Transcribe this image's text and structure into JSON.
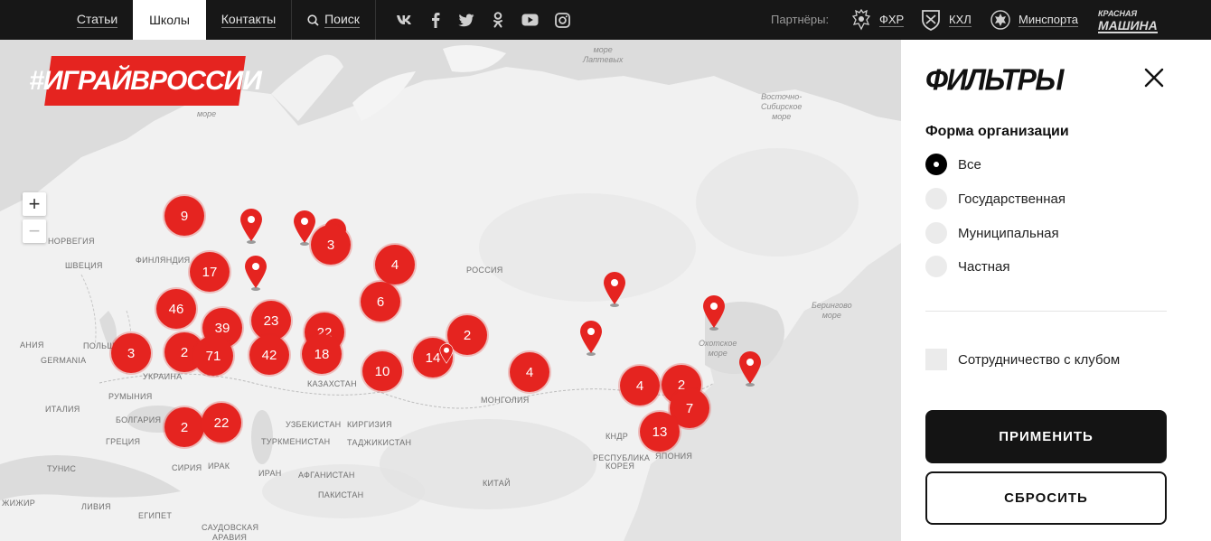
{
  "nav": {
    "items": [
      {
        "label": "Статьи"
      },
      {
        "label": "Школы",
        "active": true
      },
      {
        "label": "Контакты"
      },
      {
        "label": "Поиск"
      }
    ],
    "social_icons": [
      "vk-icon",
      "facebook-icon",
      "twitter-icon",
      "odnoklassniki-icon",
      "youtube-icon",
      "instagram-icon"
    ],
    "partners_label": "Партнёры:",
    "partners": [
      {
        "label": "ФХР",
        "icon": "fhr-emblem-icon"
      },
      {
        "label": "КХЛ",
        "icon": "khl-shield-icon"
      },
      {
        "label": "Минспорта",
        "icon": "minsport-emblem-icon"
      }
    ],
    "krasnaya_mashina": {
      "line1": "КРАСНАЯ",
      "line2": "МАШИНА"
    }
  },
  "brand": {
    "text": "#ИГРАЙВРОССИИ"
  },
  "map": {
    "zoom_in": "+",
    "zoom_out": "−",
    "countries": [
      {
        "text": "НОРВЕГИЯ"
      },
      {
        "text": "ШВЕЦИЯ"
      },
      {
        "text": "ФИНЛЯНДИЯ"
      },
      {
        "text": "РОССИЯ"
      },
      {
        "text": "ПОЛЬША"
      },
      {
        "text": "GERMANIA"
      },
      {
        "text": "АНИЯ"
      },
      {
        "text": "УКРАИНА"
      },
      {
        "text": "РУМЫНИЯ"
      },
      {
        "text": "ИТАЛИЯ"
      },
      {
        "text": "БОЛГАРИЯ"
      },
      {
        "text": "ГРЕЦИЯ"
      },
      {
        "text": "ТУНИС"
      },
      {
        "text": "СИРИЯ"
      },
      {
        "text": "ИРАК"
      },
      {
        "text": "ИРАН"
      },
      {
        "text": "ЕГИПЕТ"
      },
      {
        "text": "ЛИВИЯ"
      },
      {
        "text": "ЖИЖИР"
      },
      {
        "text": "САУДОВСКАЯ"
      },
      {
        "text": "АРАВИЯ"
      },
      {
        "text": "КАЗАХСТАН"
      },
      {
        "text": "УЗБЕКИСТАН"
      },
      {
        "text": "ТУРКМЕНИСТАН"
      },
      {
        "text": "КИРГИЗИЯ"
      },
      {
        "text": "ТАДЖИКИСТАН"
      },
      {
        "text": "АФГАНИСТАН"
      },
      {
        "text": "ПАКИСТАН"
      },
      {
        "text": "МОНГОЛИЯ"
      },
      {
        "text": "КИТАЙ"
      },
      {
        "text": "КНДР"
      },
      {
        "text": "РЕСПУБЛИКА"
      },
      {
        "text": "КОРЕЯ"
      },
      {
        "text": "ЯПОНИЯ"
      }
    ],
    "seas": [
      {
        "text": "море\nЛаптевых"
      },
      {
        "text": "Восточно-\nСибирское\nморе"
      },
      {
        "text": "Берингово\nморе"
      },
      {
        "text": "Охотское\nморе"
      },
      {
        "text": "море"
      }
    ],
    "clusters": [
      {
        "count": "9"
      },
      {
        "count": "17"
      },
      {
        "count": "46"
      },
      {
        "count": "39"
      },
      {
        "count": "3"
      },
      {
        "count": "2"
      },
      {
        "count": "71"
      },
      {
        "count": "23"
      },
      {
        "count": "42"
      },
      {
        "count": "22"
      },
      {
        "count": "18"
      },
      {
        "count": "3"
      },
      {
        "count": "4"
      },
      {
        "count": "6"
      },
      {
        "count": "10"
      },
      {
        "count": "14"
      },
      {
        "count": "2"
      },
      {
        "count": "4"
      },
      {
        "count": "2"
      },
      {
        "count": "22"
      },
      {
        "count": "4"
      },
      {
        "count": "2"
      },
      {
        "count": "7"
      },
      {
        "count": "13"
      }
    ],
    "pin_count": 8
  },
  "filters": {
    "title": "ФИЛЬТРЫ",
    "group_title": "Форма организации",
    "options": [
      {
        "label": "Все",
        "selected": true
      },
      {
        "label": "Государственная",
        "selected": false
      },
      {
        "label": "Муниципальная",
        "selected": false
      },
      {
        "label": "Частная",
        "selected": false
      }
    ],
    "checkbox_label": "Сотрудничество с клубом",
    "apply_label": "ПРИМЕНИТЬ",
    "reset_label": "СБРОСИТЬ"
  },
  "colors": {
    "accent": "#e52420",
    "topbar": "#171717",
    "button_dark": "#141414"
  }
}
